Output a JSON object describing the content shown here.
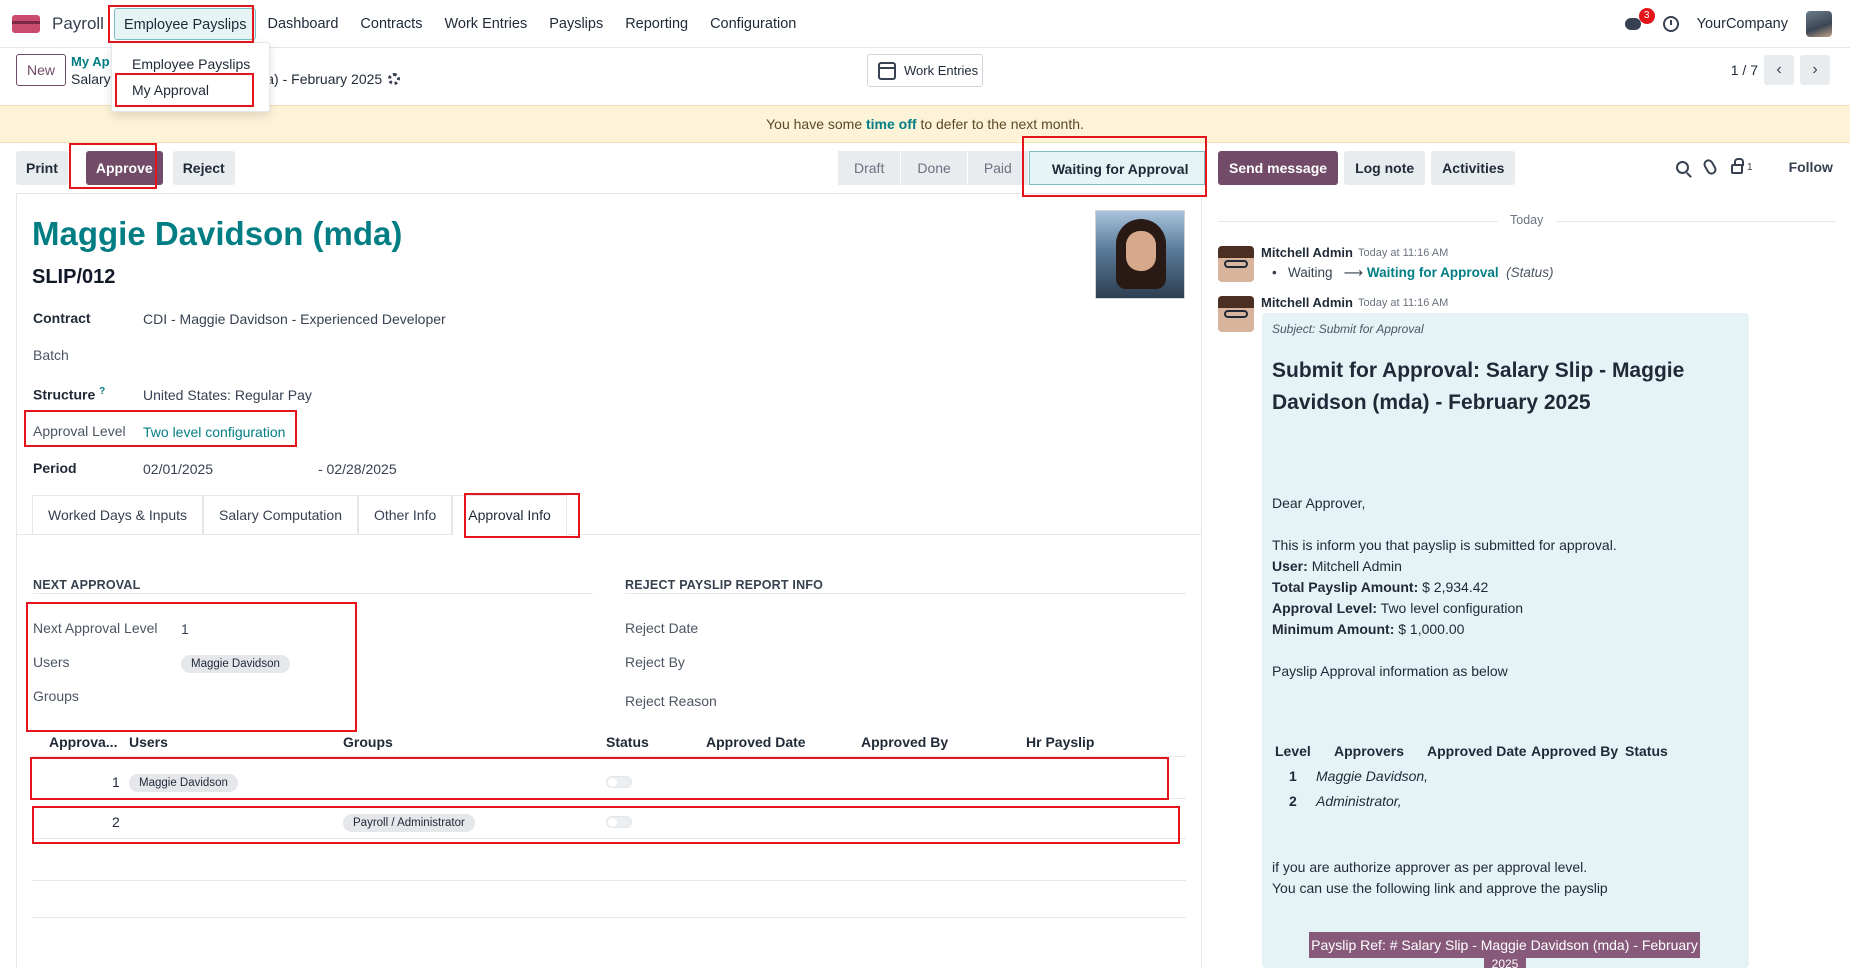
{
  "navbar": {
    "app_name": "Payroll",
    "menu": [
      "Employee Payslips",
      "Dashboard",
      "Contracts",
      "Work Entries",
      "Payslips",
      "Reporting",
      "Configuration"
    ],
    "messages_badge": "3",
    "company": "YourCompany"
  },
  "dropdown": {
    "items": [
      "Employee Payslips",
      "My Approval"
    ]
  },
  "control": {
    "new_label": "New",
    "breadcrumb_parent": "My Ap",
    "breadcrumb_current_prefix": "Salary",
    "breadcrumb_current_suffix": "nda) - February 2025",
    "work_entries_label": "Work Entries",
    "pager": "1 / 7"
  },
  "banner": {
    "before": "You have some",
    "link": "time off",
    "after": "to defer to the next month."
  },
  "actions": {
    "print": "Print",
    "approve": "Approve",
    "reject": "Reject"
  },
  "stages": [
    "Draft",
    "Done",
    "Paid",
    "Waiting for Approval"
  ],
  "chatter_buttons": {
    "send": "Send message",
    "log": "Log note",
    "activities": "Activities",
    "followers_count": "1",
    "follow": "Follow"
  },
  "form": {
    "employee_name": "Maggie Davidson (mda)",
    "slip_number": "SLIP/012",
    "contract_label": "Contract",
    "contract_value": "CDI - Maggie Davidson - Experienced Developer",
    "batch_label": "Batch",
    "structure_label": "Structure",
    "structure_help": "?",
    "structure_value": "United States: Regular Pay",
    "approval_level_label": "Approval Level",
    "approval_level_value": "Two level configuration",
    "period_label": "Period",
    "period_from": "02/01/2025",
    "period_to": "- 02/28/2025"
  },
  "tabs": [
    "Worked Days & Inputs",
    "Salary Computation",
    "Other Info",
    "Approval Info"
  ],
  "approval_info": {
    "next_approval_title": "NEXT APPROVAL",
    "next_level_label": "Next Approval Level",
    "next_level_value": "1",
    "users_label": "Users",
    "users_value": "Maggie Davidson",
    "groups_label": "Groups",
    "reject_title": "REJECT PAYSLIP REPORT INFO",
    "reject_date_label": "Reject Date",
    "reject_by_label": "Reject By",
    "reject_reason_label": "Reject Reason"
  },
  "table": {
    "headers": [
      "Approva...",
      "Users",
      "Groups",
      "Status",
      "Approved Date",
      "Approved By",
      "Hr Payslip"
    ],
    "rows": [
      {
        "level": "1",
        "user": "Maggie Davidson",
        "group": ""
      },
      {
        "level": "2",
        "user": "",
        "group": "Payroll / Administrator"
      }
    ]
  },
  "chatter": {
    "today": "Today",
    "msg1": {
      "author": "Mitchell Admin",
      "time": "Today at 11:16 AM",
      "old": "Waiting",
      "arrow": "⟶",
      "new": "Waiting for Approval",
      "field": "(Status)"
    },
    "msg2": {
      "author": "Mitchell Admin",
      "time": "Today at 11:16 AM",
      "subject": "Subject: Submit for Approval",
      "title": "Submit for Approval: Salary Slip - Maggie Davidson (mda) - February 2025",
      "greeting": "Dear Approver,",
      "intro": "This is inform you that payslip is submitted for approval.",
      "user_label": "User:",
      "user_value": "Mitchell Admin",
      "total_label": "Total Payslip Amount:",
      "total_value": "$ 2,934.42",
      "level_label": "Approval Level:",
      "level_value": "Two level configuration",
      "min_label": "Minimum Amount:",
      "min_value": "$ 1,000.00",
      "info": "Payslip Approval information as below",
      "table_headers": [
        "Level",
        "Approvers",
        "Approved Date",
        "Approved By",
        "Status"
      ],
      "table_rows": [
        {
          "level": "1",
          "approvers": "Maggie Davidson,"
        },
        {
          "level": "2",
          "approvers": "Administrator,"
        }
      ],
      "footer1": "if you are authorize approver as per approval level.",
      "footer2": "You can use the following link and approve the payslip",
      "button": "Payslip Ref: # Salary Slip - Maggie Davidson (mda) - February",
      "button_wrap": "2025"
    }
  }
}
